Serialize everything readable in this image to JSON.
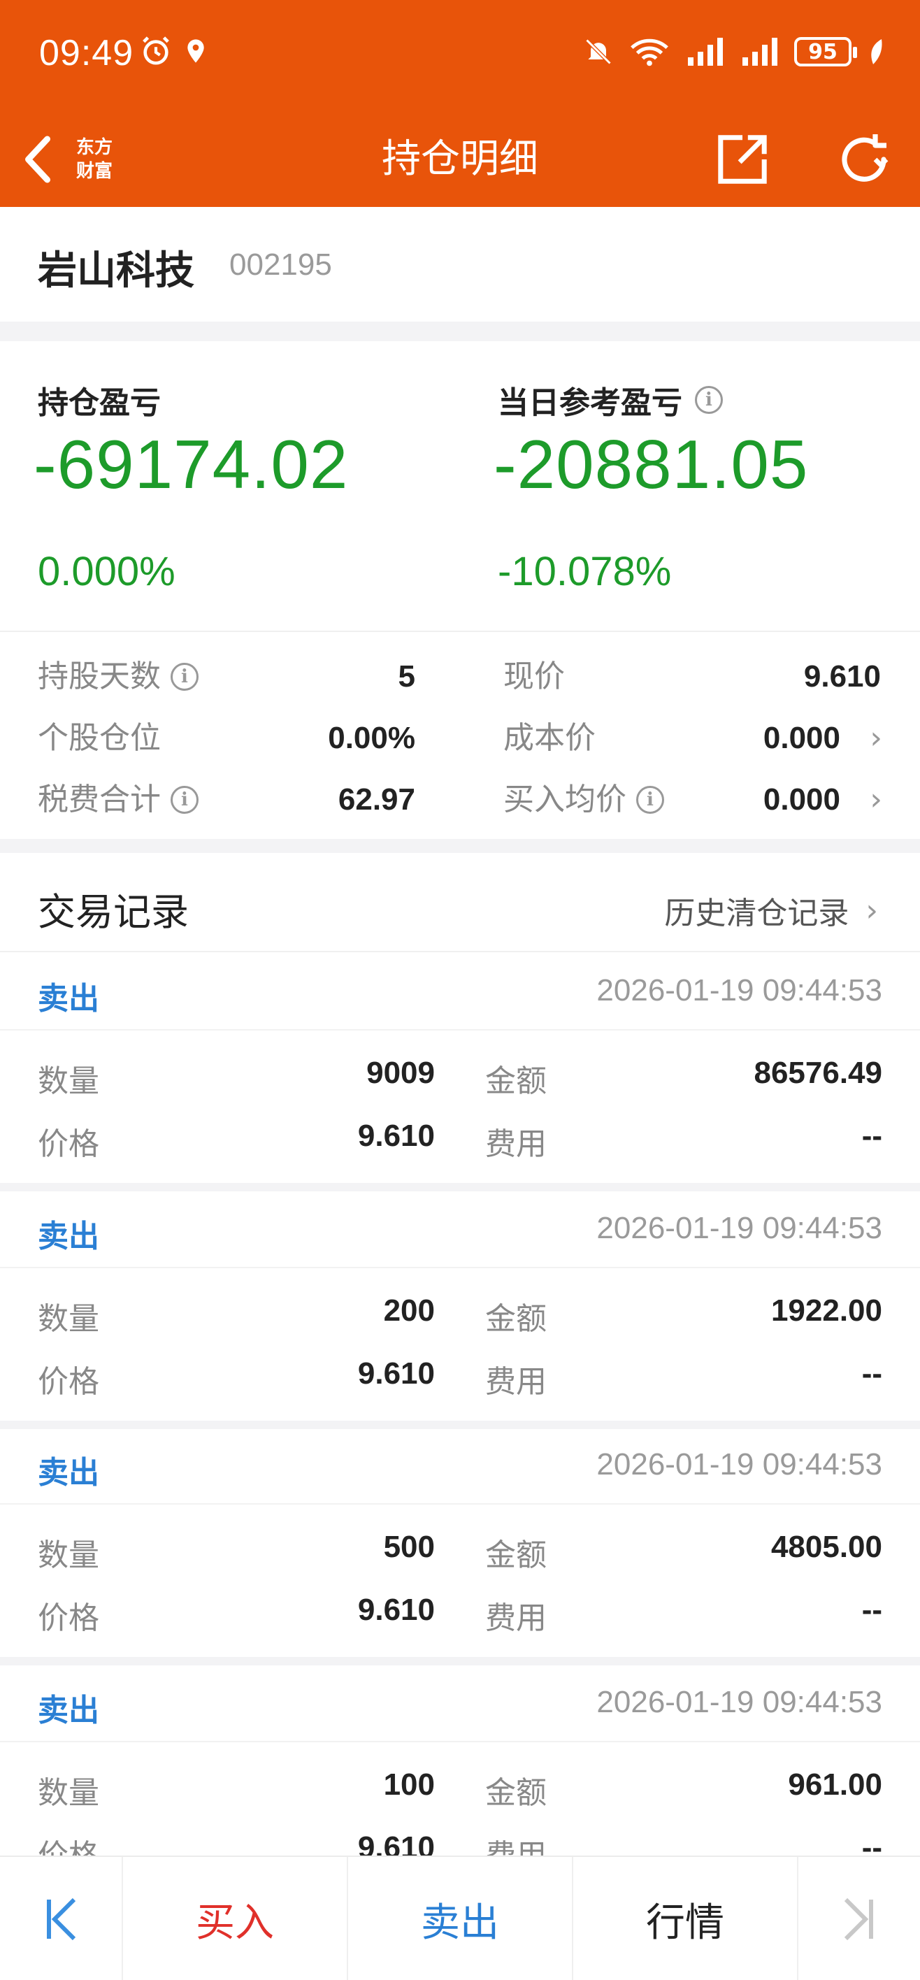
{
  "status_bar": {
    "time": "09:49",
    "battery": "95"
  },
  "nav": {
    "title": "持仓明细",
    "logo_line1": "东方",
    "logo_line2": "财富"
  },
  "stock": {
    "name": "岩山科技",
    "code": "002195"
  },
  "pnl": {
    "position_label": "持仓盈亏",
    "position_value": "-69174.02",
    "position_pct": "0.000%",
    "daily_label": "当日参考盈亏",
    "daily_value": "-20881.05",
    "daily_pct": "-10.078%"
  },
  "metrics": {
    "hold_days_label": "持股天数",
    "hold_days": "5",
    "price_label": "现价",
    "price": "9.610",
    "position_ratio_label": "个股仓位",
    "position_ratio": "0.00%",
    "cost_label": "成本价",
    "cost": "0.000",
    "fees_label": "税费合计",
    "fees": "62.97",
    "avg_buy_label": "买入均价",
    "avg_buy": "0.000"
  },
  "trades": {
    "title": "交易记录",
    "history_link": "历史清仓记录",
    "qty_label": "数量",
    "amount_label": "金额",
    "price_label": "价格",
    "fee_label": "费用",
    "records": [
      {
        "type": "卖出",
        "time": "2026-01-19 09:44:53",
        "qty": "9009",
        "amount": "86576.49",
        "price": "9.610",
        "fee": "--"
      },
      {
        "type": "卖出",
        "time": "2026-01-19 09:44:53",
        "qty": "200",
        "amount": "1922.00",
        "price": "9.610",
        "fee": "--"
      },
      {
        "type": "卖出",
        "time": "2026-01-19 09:44:53",
        "qty": "500",
        "amount": "4805.00",
        "price": "9.610",
        "fee": "--"
      },
      {
        "type": "卖出",
        "time": "2026-01-19 09:44:53",
        "qty": "100",
        "amount": "961.00",
        "price": "9.610",
        "fee": "--"
      }
    ]
  },
  "bottom_bar": {
    "buy": "买入",
    "sell": "卖出",
    "quote": "行情"
  },
  "colors": {
    "brand": "#e8540a",
    "loss_green": "#1d9b2a",
    "sell_blue": "#2a7fd4",
    "buy_red": "#e0302a"
  },
  "icons": [
    "back-icon",
    "share-icon",
    "refresh-icon",
    "info-icon",
    "chevron-right-icon",
    "first-page-icon",
    "last-page-icon"
  ]
}
